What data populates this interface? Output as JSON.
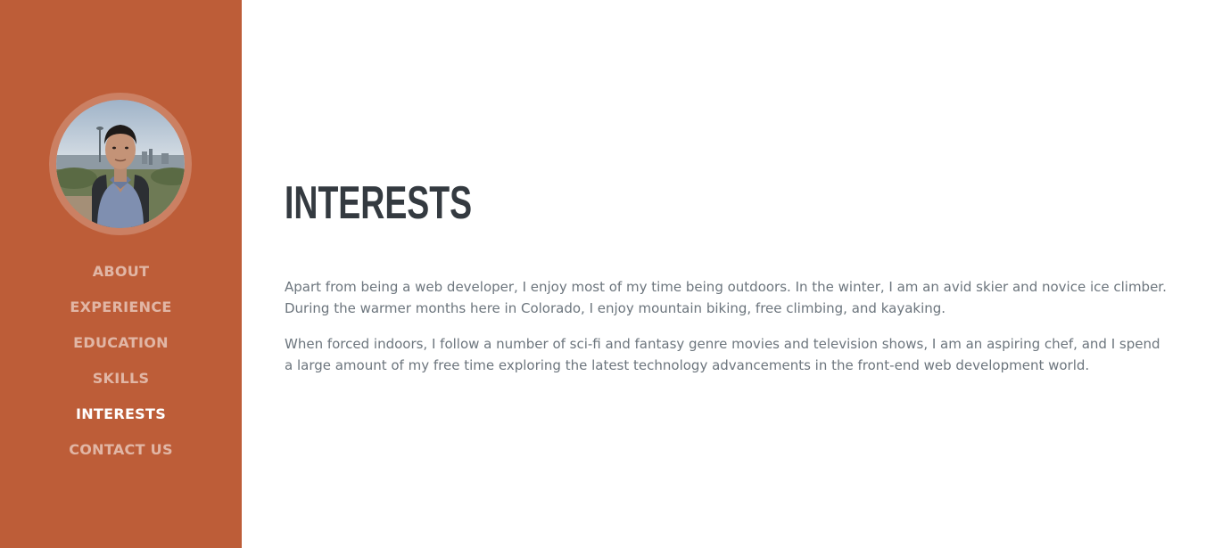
{
  "sidebar": {
    "accent_color": "#bd5d38",
    "avatar_alt": "profile photo",
    "nav": [
      {
        "label": "ABOUT",
        "active": false
      },
      {
        "label": "EXPERIENCE",
        "active": false
      },
      {
        "label": "EDUCATION",
        "active": false
      },
      {
        "label": "SKILLS",
        "active": false
      },
      {
        "label": "INTERESTS",
        "active": true
      },
      {
        "label": "CONTACT US",
        "active": false
      }
    ]
  },
  "main": {
    "title": "INTERESTS",
    "paragraphs": [
      "Apart from being a web developer, I enjoy most of my time being outdoors. In the winter, I am an avid skier and novice ice climber. During the warmer months here in Colorado, I enjoy mountain biking, free climbing, and kayaking.",
      "When forced indoors, I follow a number of sci-fi and fantasy genre movies and television shows, I am an aspiring chef, and I spend a large amount of my free time exploring the latest technology advancements in the front-end web development world."
    ]
  }
}
